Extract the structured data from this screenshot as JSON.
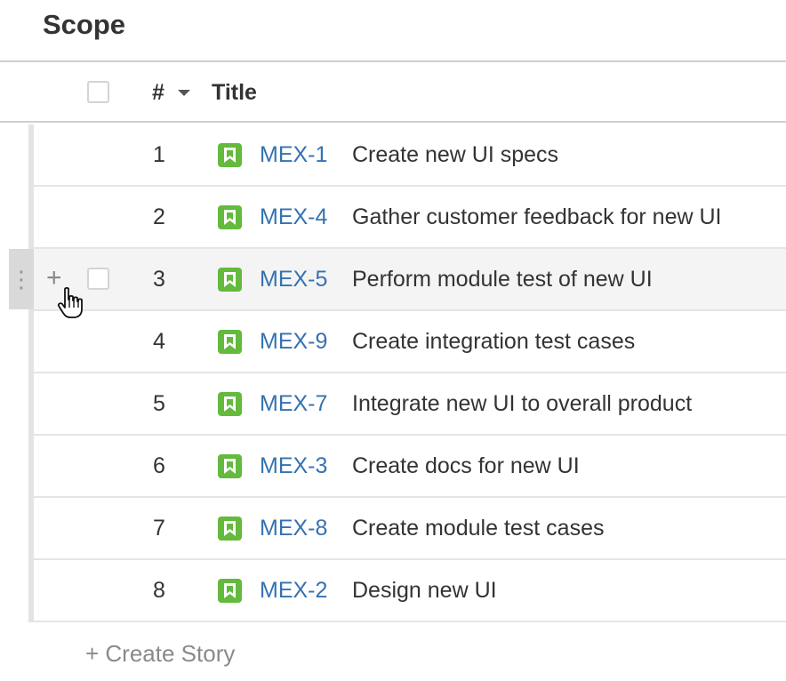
{
  "page": {
    "title": "Scope"
  },
  "table": {
    "columns": {
      "number": "#",
      "title": "Title"
    },
    "rows": [
      {
        "num": "1",
        "key": "MEX-1",
        "summary": "Create new UI specs"
      },
      {
        "num": "2",
        "key": "MEX-4",
        "summary": "Gather customer feedback for new UI"
      },
      {
        "num": "3",
        "key": "MEX-5",
        "summary": "Perform module test of new UI",
        "hovered": true
      },
      {
        "num": "4",
        "key": "MEX-9",
        "summary": "Create integration test cases"
      },
      {
        "num": "5",
        "key": "MEX-7",
        "summary": "Integrate new UI to overall product"
      },
      {
        "num": "6",
        "key": "MEX-3",
        "summary": "Create docs for new UI"
      },
      {
        "num": "7",
        "key": "MEX-8",
        "summary": "Create module test cases"
      },
      {
        "num": "8",
        "key": "MEX-2",
        "summary": "Design new UI"
      }
    ],
    "hover_controls": {
      "drag_glyph": "⋮",
      "add_glyph": "+"
    }
  },
  "footer": {
    "create_story_label": "+ Create Story"
  },
  "icons": {
    "issue_type": "story-icon",
    "cursor": "hand-pointer-icon",
    "sort": "caret-down-icon"
  },
  "colors": {
    "story": "#63ba3c",
    "link": "#3572b0",
    "hover_row": "#f4f4f4"
  }
}
